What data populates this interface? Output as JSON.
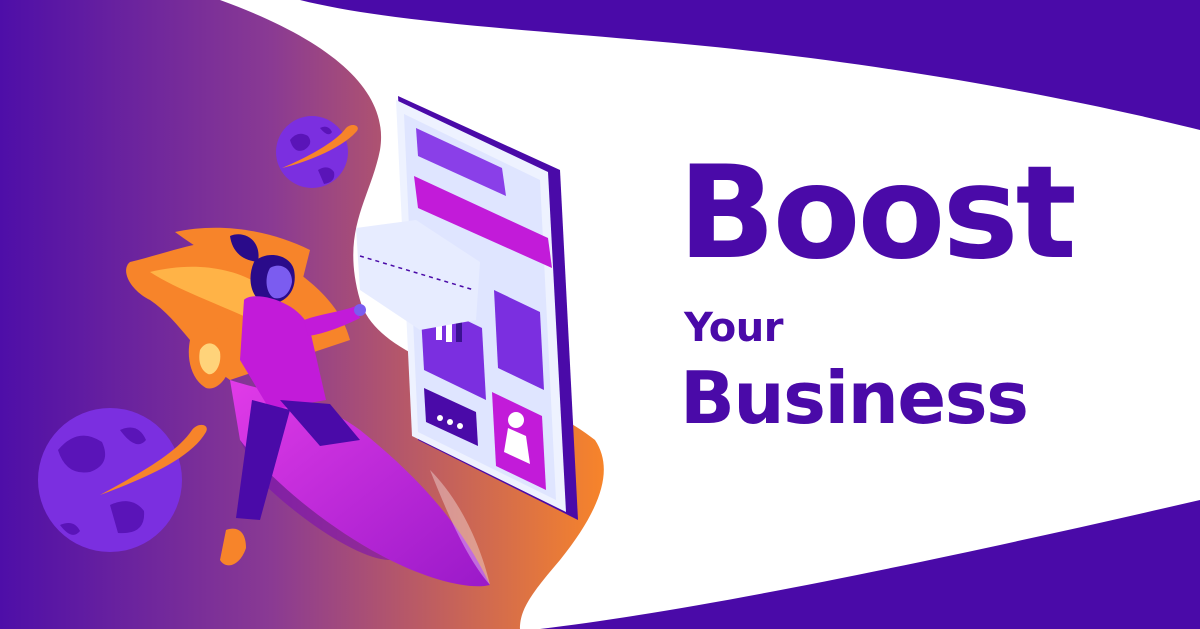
{
  "banner": {
    "headline_line1": "Boost",
    "headline_line2": "Your",
    "headline_line3": "Business"
  },
  "colors": {
    "brand_purple": "#4a0aa8",
    "magenta": "#c21bd9",
    "orange": "#f7842a",
    "white": "#ffffff"
  },
  "illustration": {
    "icons": [
      "planet-icon",
      "rocket-icon",
      "smartphone-icon",
      "chart-icon",
      "chat-bubble-icon",
      "user-profile-icon",
      "woman-figure"
    ]
  }
}
